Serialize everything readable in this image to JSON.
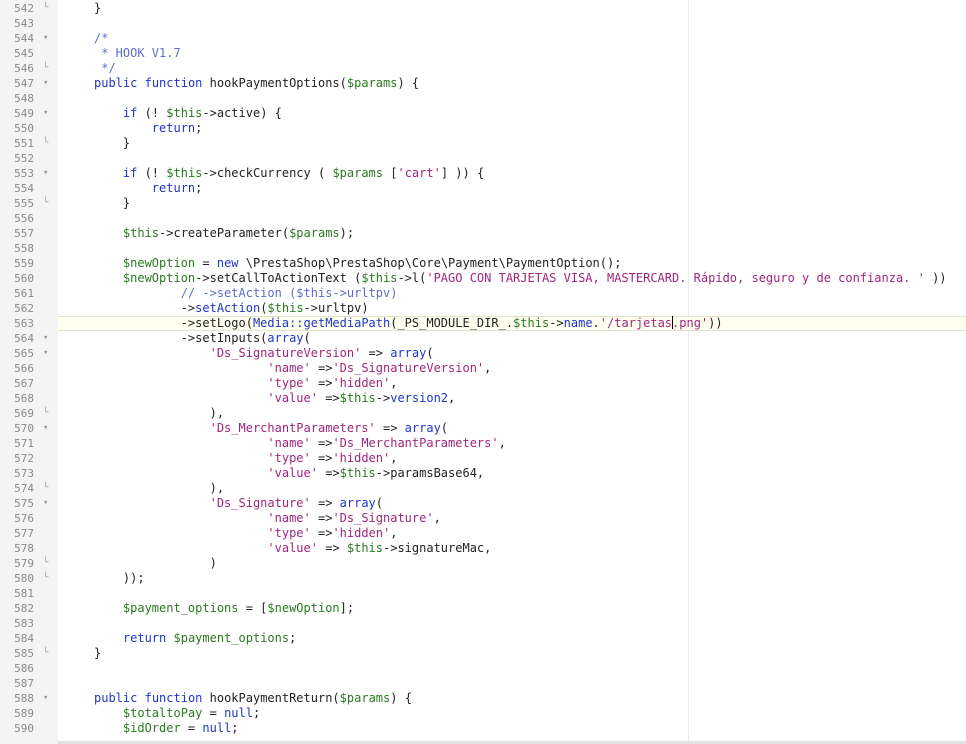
{
  "editor": {
    "lines": [
      {
        "num": "542",
        "fold": "end",
        "tokens": [
          [
            "n",
            "}"
          ]
        ]
      },
      {
        "num": "543",
        "fold": "",
        "tokens": []
      },
      {
        "num": "544",
        "fold": "start",
        "tokens": [
          [
            "c",
            "/*"
          ]
        ]
      },
      {
        "num": "545",
        "fold": "",
        "tokens": [
          [
            "c",
            " * HOOK V1.7"
          ]
        ]
      },
      {
        "num": "546",
        "fold": "end",
        "tokens": [
          [
            "c",
            " */"
          ]
        ]
      },
      {
        "num": "547",
        "fold": "start",
        "tokens": [
          [
            "k",
            "public"
          ],
          [
            "n",
            " "
          ],
          [
            "k",
            "function"
          ],
          [
            "n",
            " hookPaymentOptions("
          ],
          [
            "v",
            "$params"
          ],
          [
            "n",
            ") {"
          ]
        ]
      },
      {
        "num": "548",
        "fold": "",
        "tokens": []
      },
      {
        "num": "549",
        "fold": "start",
        "tokens": [
          [
            "n",
            "    "
          ],
          [
            "k",
            "if"
          ],
          [
            "n",
            " (! "
          ],
          [
            "v",
            "$this"
          ],
          [
            "n",
            "->active) {"
          ]
        ]
      },
      {
        "num": "550",
        "fold": "",
        "tokens": [
          [
            "n",
            "        "
          ],
          [
            "k",
            "return"
          ],
          [
            "n",
            ";"
          ]
        ]
      },
      {
        "num": "551",
        "fold": "end",
        "tokens": [
          [
            "n",
            "    }"
          ]
        ]
      },
      {
        "num": "552",
        "fold": "",
        "tokens": []
      },
      {
        "num": "553",
        "fold": "start",
        "tokens": [
          [
            "n",
            "    "
          ],
          [
            "k",
            "if"
          ],
          [
            "n",
            " (! "
          ],
          [
            "v",
            "$this"
          ],
          [
            "n",
            "->checkCurrency ( "
          ],
          [
            "v",
            "$params"
          ],
          [
            "n",
            " ["
          ],
          [
            "s",
            "'cart'"
          ],
          [
            "n",
            "] )) {"
          ]
        ]
      },
      {
        "num": "554",
        "fold": "",
        "tokens": [
          [
            "n",
            "        "
          ],
          [
            "k",
            "return"
          ],
          [
            "n",
            ";"
          ]
        ]
      },
      {
        "num": "555",
        "fold": "end",
        "tokens": [
          [
            "n",
            "    }"
          ]
        ]
      },
      {
        "num": "556",
        "fold": "",
        "tokens": []
      },
      {
        "num": "557",
        "fold": "",
        "tokens": [
          [
            "n",
            "    "
          ],
          [
            "v",
            "$this"
          ],
          [
            "n",
            "->createParameter("
          ],
          [
            "v",
            "$params"
          ],
          [
            "n",
            ");"
          ]
        ]
      },
      {
        "num": "558",
        "fold": "",
        "tokens": []
      },
      {
        "num": "559",
        "fold": "",
        "tokens": [
          [
            "n",
            "    "
          ],
          [
            "v",
            "$newOption"
          ],
          [
            "n",
            " = "
          ],
          [
            "k",
            "new"
          ],
          [
            "n",
            " \\PrestaShop\\PrestaShop\\Core\\Payment\\PaymentOption();"
          ]
        ]
      },
      {
        "num": "560",
        "fold": "",
        "tokens": [
          [
            "n",
            "    "
          ],
          [
            "v",
            "$newOption"
          ],
          [
            "n",
            "->setCallToActionText ("
          ],
          [
            "v",
            "$this"
          ],
          [
            "n",
            "->l("
          ],
          [
            "s",
            "'PAGO CON TARJETAS VISA, MASTERCARD. Rápido, seguro y de confianza. '"
          ],
          [
            "n",
            " ))"
          ]
        ]
      },
      {
        "num": "561",
        "fold": "",
        "tokens": [
          [
            "c",
            "            // ->setAction ($this->urltpv)"
          ]
        ]
      },
      {
        "num": "562",
        "fold": "",
        "tokens": [
          [
            "n",
            "            ->"
          ],
          [
            "m",
            "setAction"
          ],
          [
            "n",
            "("
          ],
          [
            "v",
            "$this"
          ],
          [
            "n",
            "->urltpv)"
          ]
        ]
      },
      {
        "num": "563",
        "fold": "",
        "current": true,
        "tokens": [
          [
            "n",
            "            ->setLogo("
          ],
          [
            "m",
            "Media::getMediaPath"
          ],
          [
            "n",
            "(_PS_MODULE_DIR_."
          ],
          [
            "v",
            "$this"
          ],
          [
            "n",
            "->"
          ],
          [
            "m",
            "name"
          ],
          [
            "n",
            "."
          ],
          [
            "s",
            "'/tarjetas"
          ],
          [
            "caret",
            ""
          ],
          [
            "s",
            ".png'"
          ],
          [
            "n",
            "))"
          ]
        ]
      },
      {
        "num": "564",
        "fold": "start",
        "tokens": [
          [
            "n",
            "            ->setInputs("
          ],
          [
            "k",
            "array"
          ],
          [
            "n",
            "("
          ]
        ]
      },
      {
        "num": "565",
        "fold": "start",
        "tokens": [
          [
            "n",
            "                "
          ],
          [
            "s",
            "'Ds_SignatureVersion'"
          ],
          [
            "n",
            " => "
          ],
          [
            "k",
            "array"
          ],
          [
            "n",
            "("
          ]
        ]
      },
      {
        "num": "566",
        "fold": "",
        "tokens": [
          [
            "n",
            "                        "
          ],
          [
            "s",
            "'name'"
          ],
          [
            "n",
            " =>"
          ],
          [
            "s",
            "'Ds_SignatureVersion'"
          ],
          [
            "n",
            ","
          ]
        ]
      },
      {
        "num": "567",
        "fold": "",
        "tokens": [
          [
            "n",
            "                        "
          ],
          [
            "s",
            "'type'"
          ],
          [
            "n",
            " =>"
          ],
          [
            "s",
            "'hidden'"
          ],
          [
            "n",
            ","
          ]
        ]
      },
      {
        "num": "568",
        "fold": "",
        "tokens": [
          [
            "n",
            "                        "
          ],
          [
            "s",
            "'value'"
          ],
          [
            "n",
            " =>"
          ],
          [
            "v",
            "$this"
          ],
          [
            "n",
            "->"
          ],
          [
            "m",
            "version2"
          ],
          [
            "n",
            ","
          ]
        ]
      },
      {
        "num": "569",
        "fold": "end",
        "tokens": [
          [
            "n",
            "                ),"
          ]
        ]
      },
      {
        "num": "570",
        "fold": "start",
        "tokens": [
          [
            "n",
            "                "
          ],
          [
            "s",
            "'Ds_MerchantParameters'"
          ],
          [
            "n",
            " => "
          ],
          [
            "k",
            "array"
          ],
          [
            "n",
            "("
          ]
        ]
      },
      {
        "num": "571",
        "fold": "",
        "tokens": [
          [
            "n",
            "                        "
          ],
          [
            "s",
            "'name'"
          ],
          [
            "n",
            " =>"
          ],
          [
            "s",
            "'Ds_MerchantParameters'"
          ],
          [
            "n",
            ","
          ]
        ]
      },
      {
        "num": "572",
        "fold": "",
        "tokens": [
          [
            "n",
            "                        "
          ],
          [
            "s",
            "'type'"
          ],
          [
            "n",
            " =>"
          ],
          [
            "s",
            "'hidden'"
          ],
          [
            "n",
            ","
          ]
        ]
      },
      {
        "num": "573",
        "fold": "",
        "tokens": [
          [
            "n",
            "                        "
          ],
          [
            "s",
            "'value'"
          ],
          [
            "n",
            " =>"
          ],
          [
            "v",
            "$this"
          ],
          [
            "n",
            "->paramsBase64,"
          ]
        ]
      },
      {
        "num": "574",
        "fold": "end",
        "tokens": [
          [
            "n",
            "                ),"
          ]
        ]
      },
      {
        "num": "575",
        "fold": "start",
        "tokens": [
          [
            "n",
            "                "
          ],
          [
            "s",
            "'Ds_Signature'"
          ],
          [
            "n",
            " => "
          ],
          [
            "k",
            "array"
          ],
          [
            "n",
            "("
          ]
        ]
      },
      {
        "num": "576",
        "fold": "",
        "tokens": [
          [
            "n",
            "                        "
          ],
          [
            "s",
            "'name'"
          ],
          [
            "n",
            " =>"
          ],
          [
            "s",
            "'Ds_Signature'"
          ],
          [
            "n",
            ","
          ]
        ]
      },
      {
        "num": "577",
        "fold": "",
        "tokens": [
          [
            "n",
            "                        "
          ],
          [
            "s",
            "'type'"
          ],
          [
            "n",
            " =>"
          ],
          [
            "s",
            "'hidden'"
          ],
          [
            "n",
            ","
          ]
        ]
      },
      {
        "num": "578",
        "fold": "",
        "tokens": [
          [
            "n",
            "                        "
          ],
          [
            "s",
            "'value'"
          ],
          [
            "n",
            " => "
          ],
          [
            "v",
            "$this"
          ],
          [
            "n",
            "->signatureMac,"
          ]
        ]
      },
      {
        "num": "579",
        "fold": "end",
        "tokens": [
          [
            "n",
            "                )"
          ]
        ]
      },
      {
        "num": "580",
        "fold": "end",
        "tokens": [
          [
            "n",
            "    ));"
          ]
        ]
      },
      {
        "num": "581",
        "fold": "",
        "tokens": []
      },
      {
        "num": "582",
        "fold": "",
        "tokens": [
          [
            "n",
            "    "
          ],
          [
            "v",
            "$payment_options"
          ],
          [
            "n",
            " = ["
          ],
          [
            "v",
            "$newOption"
          ],
          [
            "n",
            "];"
          ]
        ]
      },
      {
        "num": "583",
        "fold": "",
        "tokens": []
      },
      {
        "num": "584",
        "fold": "",
        "tokens": [
          [
            "n",
            "    "
          ],
          [
            "k",
            "return"
          ],
          [
            "n",
            " "
          ],
          [
            "v",
            "$payment_options"
          ],
          [
            "n",
            ";"
          ]
        ]
      },
      {
        "num": "585",
        "fold": "end",
        "tokens": [
          [
            "n",
            "}"
          ]
        ]
      },
      {
        "num": "586",
        "fold": "",
        "tokens": []
      },
      {
        "num": "587",
        "fold": "",
        "tokens": []
      },
      {
        "num": "588",
        "fold": "start",
        "tokens": [
          [
            "k",
            "public"
          ],
          [
            "n",
            " "
          ],
          [
            "k",
            "function"
          ],
          [
            "n",
            " hookPaymentReturn("
          ],
          [
            "v",
            "$params"
          ],
          [
            "n",
            ") {"
          ]
        ]
      },
      {
        "num": "589",
        "fold": "",
        "tokens": [
          [
            "n",
            "    "
          ],
          [
            "v",
            "$totaltoPay"
          ],
          [
            "n",
            " = "
          ],
          [
            "k",
            "null"
          ],
          [
            "n",
            ";"
          ]
        ]
      },
      {
        "num": "590",
        "fold": "",
        "tokens": [
          [
            "n",
            "    "
          ],
          [
            "v",
            "$idOrder"
          ],
          [
            "n",
            " = "
          ],
          [
            "k",
            "null"
          ],
          [
            "n",
            ";"
          ]
        ]
      }
    ]
  }
}
